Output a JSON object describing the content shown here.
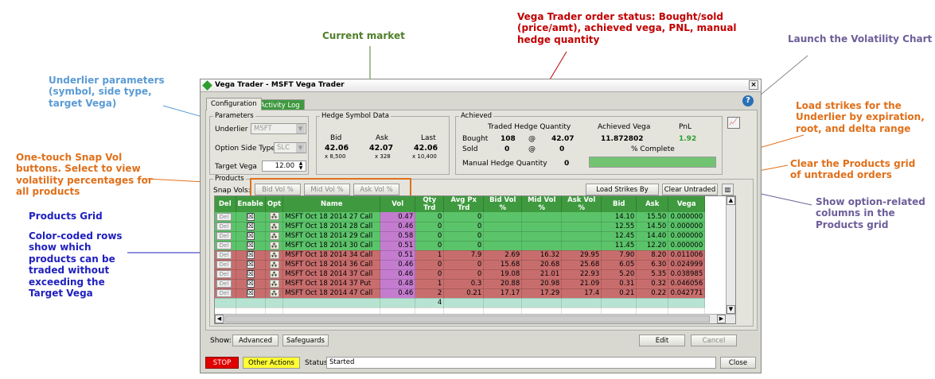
{
  "annotations": {
    "underlier": "Underlier parameters (symbol, side type, target Vega)",
    "current_market": "Current market",
    "order_status": "Vega Trader order status: Bought/sold (price/amt), achieved vega, PNL, manual hedge quantity",
    "launch_vol": "Launch the Volatility Chart",
    "load_strikes": "Load strikes for the Underlier by expiration, root, and delta range",
    "snap_vol": "One-touch Snap Vol buttons. Select to view volatility percentages for all products",
    "clear_grid": "Clear the Products grid of untraded orders",
    "products_grid": "Products Grid",
    "color_rows": "Color-coded rows show which products can be traded without exceeding the Target Vega",
    "option_cols": "Show option-related columns in the Products grid"
  },
  "window": {
    "title": "Vega Trader - MSFT Vega Trader",
    "close": "×",
    "tabs": [
      "Configuration",
      "Activity Log"
    ]
  },
  "parameters": {
    "label": "Parameters",
    "underlier_label": "Underlier",
    "underlier_value": "MSFT",
    "side_label": "Option Side Type",
    "side_value": "SLC",
    "target_label": "Target Vega",
    "target_value": "12.00"
  },
  "hedge": {
    "label": "Hedge Symbol Data",
    "bid_label": "Bid",
    "bid": "42.06",
    "bid_size": "x 8,500",
    "ask_label": "Ask",
    "ask": "42.07",
    "ask_size": "x 328",
    "last_label": "Last",
    "last": "42.06",
    "last_size": "x 10,400"
  },
  "achieved": {
    "label": "Achieved",
    "thq_label": "Traded Hedge Quantity",
    "av_label": "Achieved Vega",
    "pnl_label": "PnL",
    "bought_label": "Bought",
    "bought_qty": "108",
    "at1": "@",
    "bought_price": "42.07",
    "vega": "11.872802",
    "pnl": "1.92",
    "sold_label": "Sold",
    "sold_qty": "0",
    "at2": "@",
    "sold_price": "0",
    "pct_label": "% Complete",
    "progress": 1.0,
    "mhq_label": "Manual Hedge Quantity",
    "mhq_value": "0"
  },
  "products": {
    "label": "Products",
    "snap_label": "Snap Vols:",
    "bid_vol": "Bid Vol %",
    "mid_vol": "Mid Vol %",
    "ask_vol": "Ask Vol %",
    "load_strikes": "Load Strikes By Delta",
    "clear_untraded": "Clear Untraded",
    "columns": [
      "Del",
      "Enable",
      "Opt",
      "Name",
      "Vol",
      "Qty Trd",
      "Avg Px Trd",
      "Bid Vol %",
      "Mid Vol %",
      "Ask Vol %",
      "Bid",
      "Ask",
      "Vega"
    ],
    "del_label": "Del",
    "rows": [
      {
        "color": "green",
        "name": "MSFT Oct 18 2014 27 Call",
        "vol": "0.47",
        "qty": "0",
        "avg": "0",
        "bidv": "",
        "midv": "",
        "askv": "",
        "bid": "14.10",
        "ask": "15.50",
        "vega": "0.000000"
      },
      {
        "color": "green",
        "name": "MSFT Oct 18 2014 28 Call",
        "vol": "0.46",
        "qty": "0",
        "avg": "0",
        "bidv": "",
        "midv": "",
        "askv": "",
        "bid": "12.55",
        "ask": "14.50",
        "vega": "0.000000"
      },
      {
        "color": "green",
        "name": "MSFT Oct 18 2014 29 Call",
        "vol": "0.58",
        "qty": "0",
        "avg": "0",
        "bidv": "",
        "midv": "",
        "askv": "",
        "bid": "12.45",
        "ask": "14.40",
        "vega": "0.000000"
      },
      {
        "color": "green",
        "name": "MSFT Oct 18 2014 30 Call",
        "vol": "0.51",
        "qty": "0",
        "avg": "0",
        "bidv": "",
        "midv": "",
        "askv": "",
        "bid": "11.45",
        "ask": "12.20",
        "vega": "0.000000"
      },
      {
        "color": "red",
        "name": "MSFT Oct 18 2014 34 Call",
        "vol": "0.51",
        "qty": "1",
        "avg": "7.9",
        "bidv": "2.69",
        "midv": "16.32",
        "askv": "29.95",
        "bid": "7.90",
        "ask": "8.20",
        "vega": "0.011006"
      },
      {
        "color": "red",
        "name": "MSFT Oct 18 2014 36 Call",
        "vol": "0.46",
        "qty": "0",
        "avg": "0",
        "bidv": "15.68",
        "midv": "20.68",
        "askv": "25.68",
        "bid": "6.05",
        "ask": "6.30",
        "vega": "0.024999"
      },
      {
        "color": "red",
        "name": "MSFT Oct 18 2014 37 Call",
        "vol": "0.46",
        "qty": "0",
        "avg": "0",
        "bidv": "19.08",
        "midv": "21.01",
        "askv": "22.93",
        "bid": "5.20",
        "ask": "5.35",
        "vega": "0.038985"
      },
      {
        "color": "red",
        "name": "MSFT Oct 18 2014 37 Put",
        "vol": "0.48",
        "qty": "1",
        "avg": "0.3",
        "bidv": "20.88",
        "midv": "20.98",
        "askv": "21.09",
        "bid": "0.31",
        "ask": "0.32",
        "vega": "0.046056"
      },
      {
        "color": "red",
        "name": "MSFT Oct 18 2014 47 Call",
        "vol": "0.46",
        "qty": "2",
        "avg": "0.21",
        "bidv": "17.17",
        "midv": "17.29",
        "askv": "17.4",
        "bid": "0.21",
        "ask": "0.22",
        "vega": "0.042771"
      }
    ],
    "total_qty": "4"
  },
  "footer": {
    "show_label": "Show:",
    "advanced": "Advanced",
    "safeguards": "Safeguards",
    "edit": "Edit",
    "cancel": "Cancel",
    "stop": "STOP",
    "other_actions": "Other Actions",
    "status_label": "Status",
    "status_value": "Started",
    "close": "Close"
  },
  "colors": {
    "green_row": "#5bc46a",
    "red_row": "#c86d6d",
    "vol_cell": "#c47ccf",
    "header": "#3f9a3f",
    "stop": "#e00000",
    "other_actions": "#ffff33",
    "pnl": "#2e9e2e"
  }
}
